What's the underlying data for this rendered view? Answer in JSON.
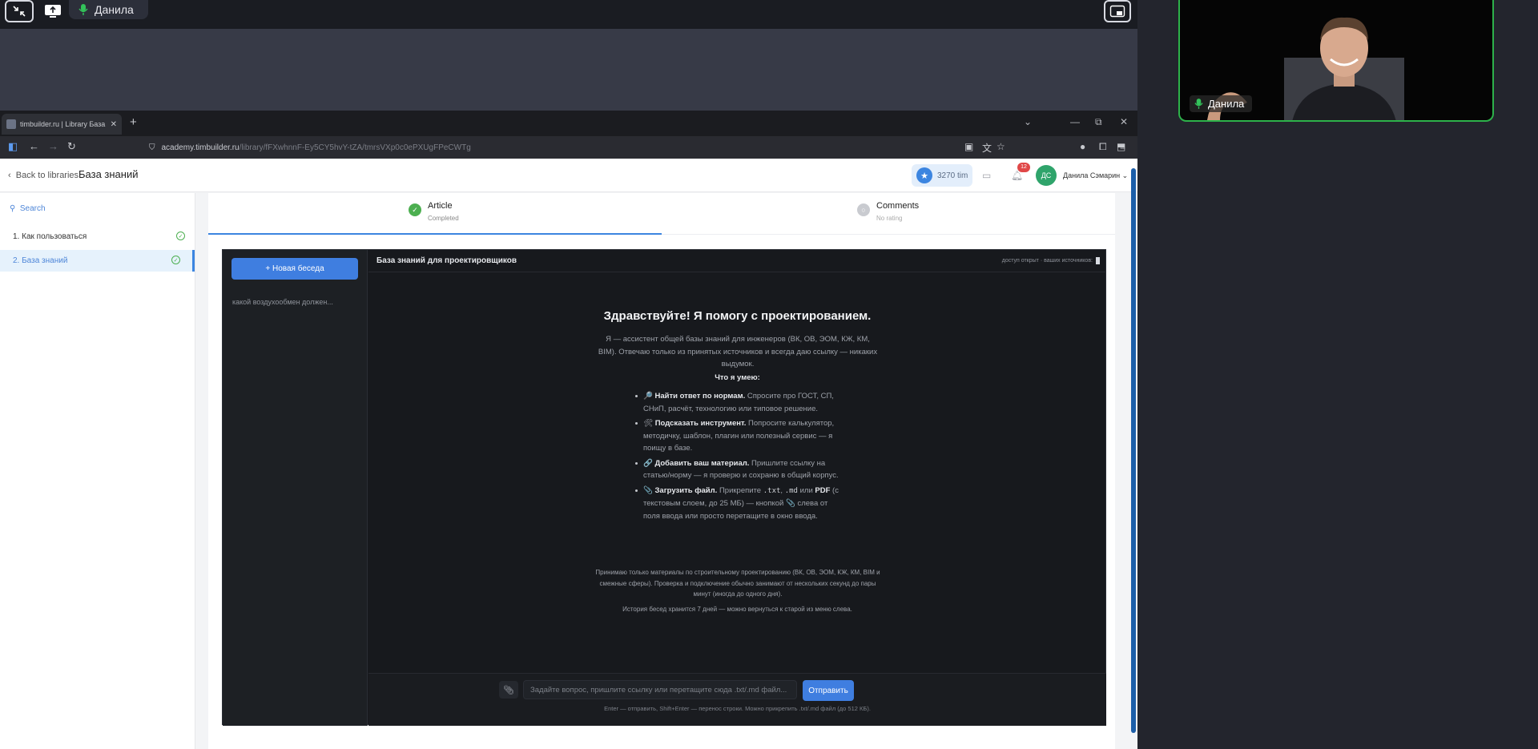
{
  "meeting": {
    "share_user_name": "Данила",
    "participant_name": "Данила"
  },
  "browser": {
    "tab_title": "timbuilder.ru | Library База знан",
    "url_host": "academy.timbuilder.ru",
    "url_path": "/library/fFXwhnnF-Ey5CY5hvY-tZA/tmrsVXp0c0ePXUgFPeCWTg"
  },
  "page": {
    "back_link": "Back to libraries",
    "library_title": "База знаний",
    "points": "3270 tim",
    "notifications_count": "12",
    "avatar_initials": "ДС",
    "user_name": "Данила Сэмарин"
  },
  "sidebar": {
    "search": "Search",
    "items": [
      {
        "label": "1. Как пользоваться",
        "completed": true,
        "active": false
      },
      {
        "label": "2. База знаний",
        "completed": true,
        "active": true
      }
    ]
  },
  "tabs": [
    {
      "title": "Article",
      "subtitle": "Completed",
      "status": "completed"
    },
    {
      "title": "Comments",
      "subtitle": "No rating",
      "status": "pending"
    }
  ],
  "chat": {
    "new_chat_button": "+ Новая беседа",
    "history": [
      "какой воздухообмен должен..."
    ],
    "title": "База знаний для проектировщиков",
    "access_note": "доступ открыт · ваших источников:",
    "welcome_title": "Здравствуйте! Я помогу с проектированием.",
    "welcome_intro": "Я — ассистент общей базы знаний для инженеров (ВК, ОВ, ЭОМ, КЖ, КМ, BIM). Отвечаю только из принятых источников и всегда даю ссылку — никаких выдумок.",
    "can_heading": "Что я умею:",
    "capabilities": [
      {
        "icon": "🔎",
        "bold": "Найти ответ по нормам.",
        "text": " Спросите про ГОСТ, СП, СНиП, расчёт, технологию или типовое решение."
      },
      {
        "icon": "🛠",
        "bold": "Подсказать инструмент.",
        "text": " Попросите калькулятор, методичку, шаблон, плагин или полезный сервис — я поищу в базе."
      },
      {
        "icon": "🔗",
        "bold": "Добавить ваш материал.",
        "text": " Пришлите ссылку на статью/норму — я проверю и сохраню в общий корпус."
      },
      {
        "icon": "📎",
        "bold": "Загрузить файл.",
        "text_pre": " Прикрепите ",
        "code1": ".txt",
        "sep": ", ",
        "code2": ".md",
        "mid": " или ",
        "bold2": "PDF",
        "text_post": " (с текстовым слоем, до 25 МБ) — кнопкой 📎 слева от поля ввода или просто перетащите в окно ввода."
      }
    ],
    "note": "Принимаю только материалы по строительному проектированию (ВК, ОВ, ЭОМ, КЖ, КМ, BIM и смежные сферы). Проверка и подключение обычно занимают от нескольких секунд до пары минут (иногда до одного дня).",
    "history_note": "История бесед хранится 7 дней — можно вернуться к старой из меню слева.",
    "input_placeholder": "Задайте вопрос, пришлите ссылку или перетащите сюда .txt/.md файл...",
    "send_button": "Отправить",
    "input_hint": "Enter — отправить, Shift+Enter — перенос строки. Можно прикрепить .txt/.md файл (до 512 КБ)."
  },
  "colors": {
    "accent": "#3f7ee0",
    "success": "#4caf50",
    "speaker_border": "#2db24a"
  },
  "icons": [
    "exit-fullscreen-icon",
    "screen-share-icon",
    "microphone-icon",
    "picture-in-picture-icon",
    "search-icon",
    "check-circle-icon",
    "star-icon",
    "bell-icon",
    "chat-icon",
    "paperclip-icon"
  ]
}
